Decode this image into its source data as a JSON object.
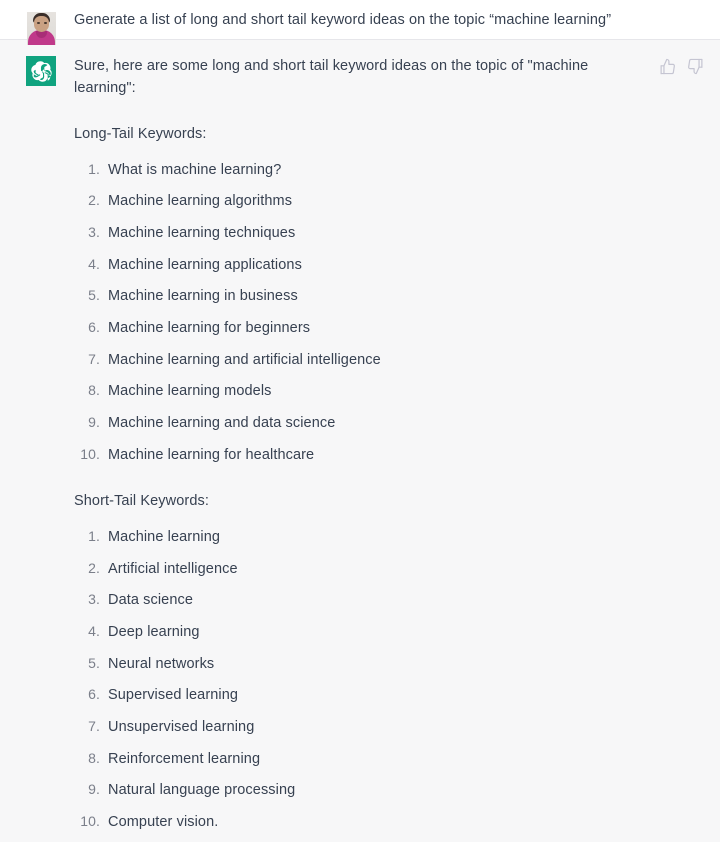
{
  "conversation": {
    "user_turn": {
      "avatar_name": "user-photo-avatar",
      "message": "Generate a list of long and short tail keyword ideas on the topic “machine learning”"
    },
    "assistant_turn": {
      "avatar_name": "chatgpt-logo",
      "brand_color": "#10a37f",
      "intro": "Sure, here are some long and short tail keyword ideas on the topic of \"machine learning\":",
      "feedback": {
        "thumbs_up_label": "thumbs-up",
        "thumbs_down_label": "thumbs-down",
        "icon_color": "#c5c5d2"
      },
      "sections": [
        {
          "heading": "Long-Tail Keywords:",
          "items": [
            "What is machine learning?",
            "Machine learning algorithms",
            "Machine learning techniques",
            "Machine learning applications",
            "Machine learning in business",
            "Machine learning for beginners",
            "Machine learning and artificial intelligence",
            "Machine learning models",
            "Machine learning and data science",
            "Machine learning for healthcare"
          ],
          "numbers": [
            "1.",
            "2.",
            "3.",
            "4.",
            "5.",
            "6.",
            "7.",
            "8.",
            "9.",
            "10."
          ]
        },
        {
          "heading": "Short-Tail Keywords:",
          "items": [
            "Machine learning",
            "Artificial intelligence",
            "Data science",
            "Deep learning",
            "Neural networks",
            "Supervised learning",
            "Unsupervised learning",
            "Reinforcement learning",
            "Natural language processing",
            "Computer vision."
          ],
          "numbers": [
            "1.",
            "2.",
            "3.",
            "4.",
            "5.",
            "6.",
            "7.",
            "8.",
            "9.",
            "10."
          ]
        }
      ]
    }
  },
  "theme": {
    "user_bg": "#ffffff",
    "assistant_bg": "#f7f7f8",
    "text_color": "#374151",
    "number_color": "#7b7f8a"
  }
}
